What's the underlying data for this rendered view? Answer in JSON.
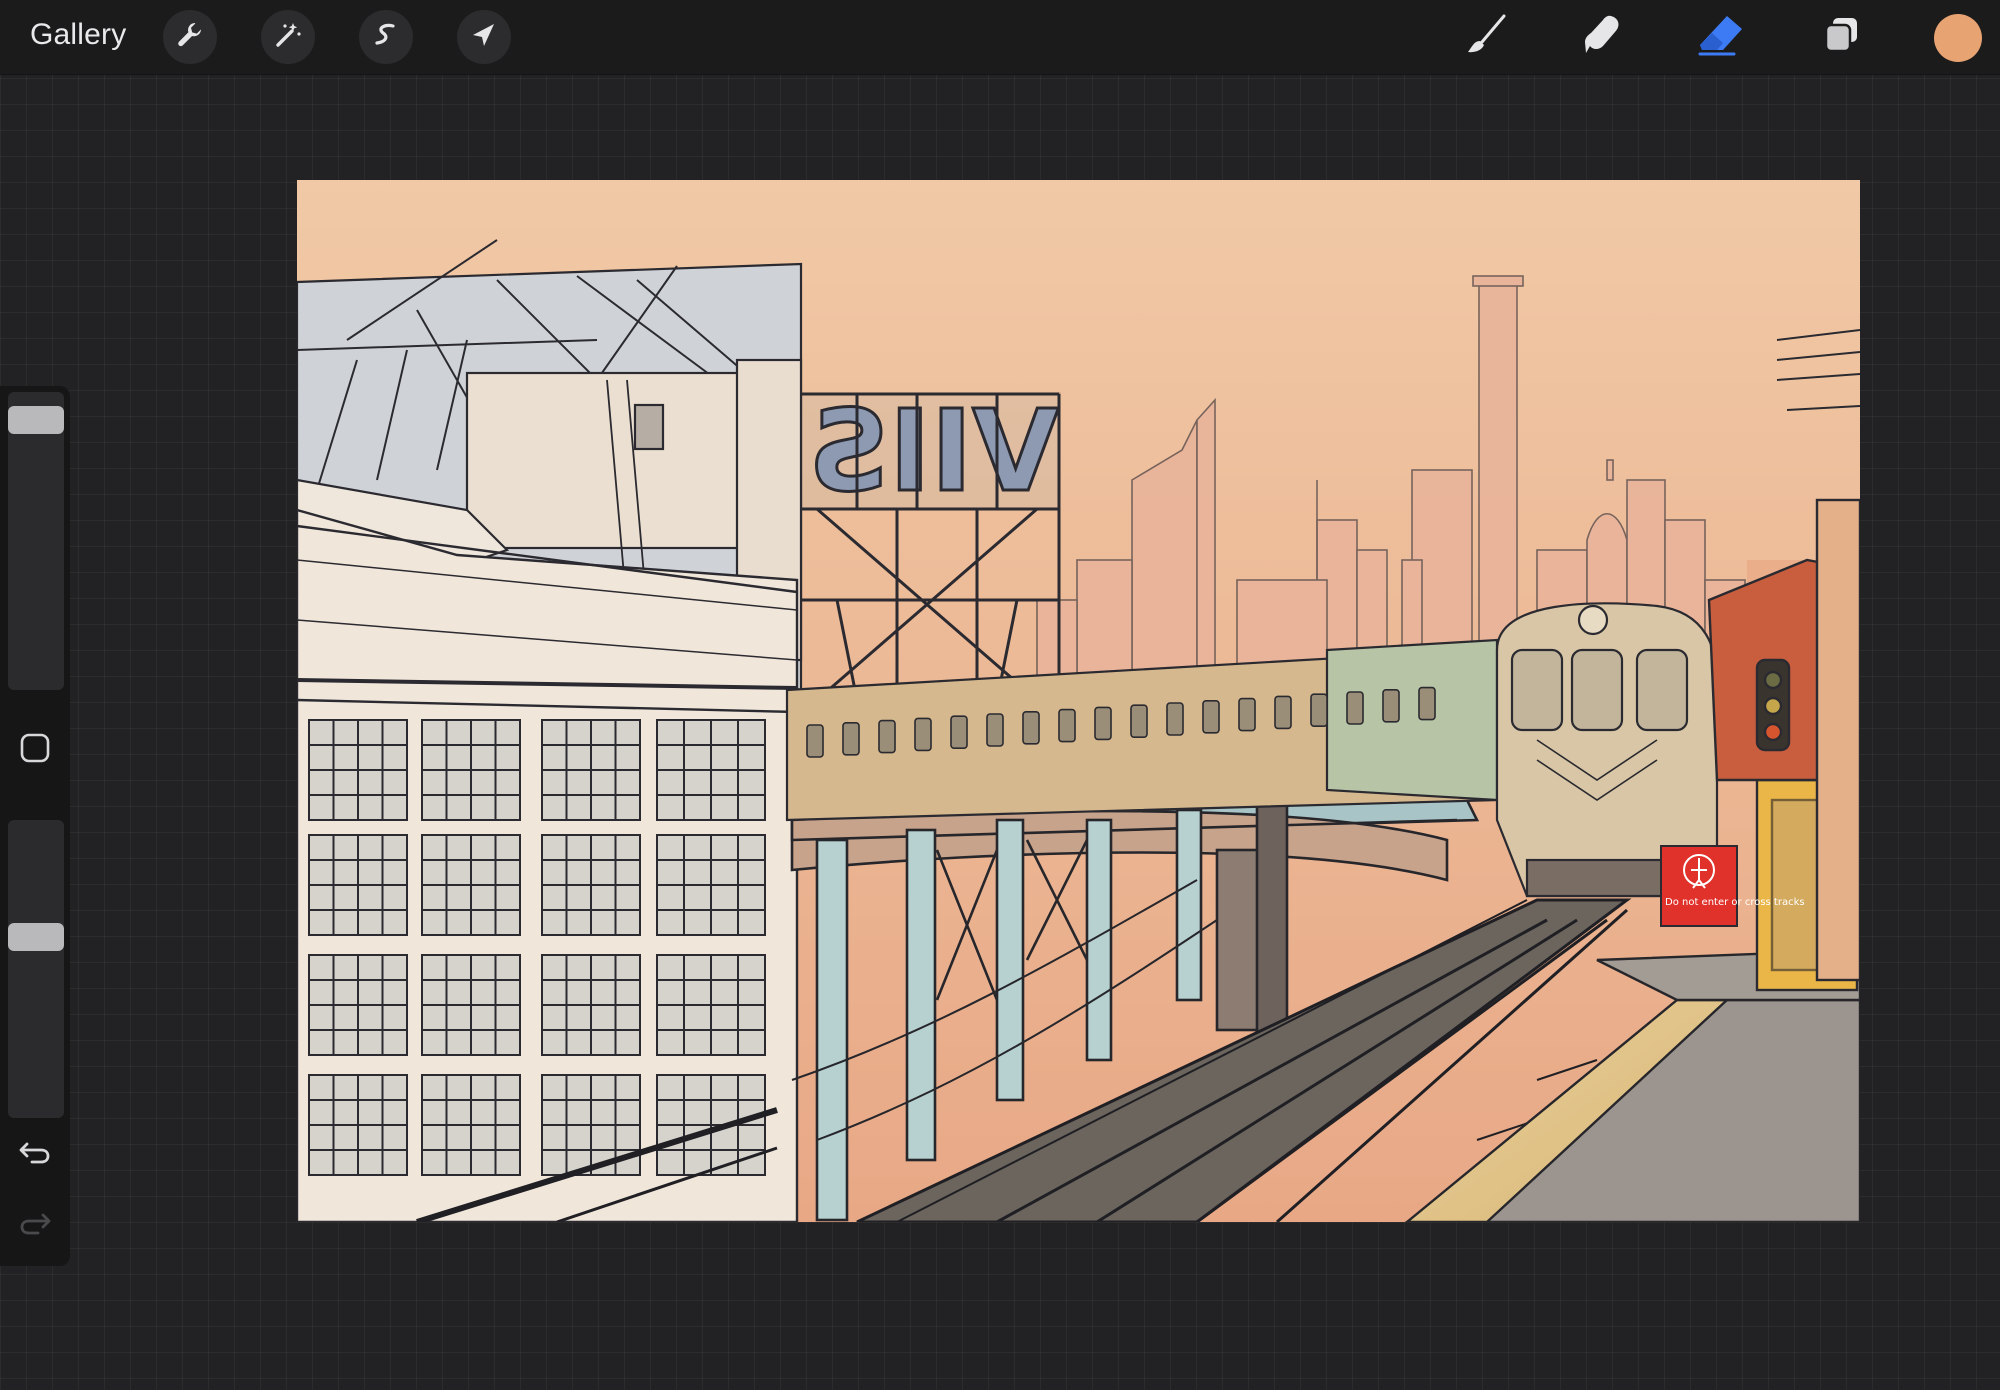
{
  "toolbar": {
    "gallery_label": "Gallery",
    "left_tools": [
      {
        "name": "actions",
        "icon": "wrench-icon"
      },
      {
        "name": "adjustments",
        "icon": "magic-wand-icon"
      },
      {
        "name": "selection",
        "icon": "selection-s-icon"
      },
      {
        "name": "transform",
        "icon": "arrow-cursor-icon"
      }
    ],
    "right_tools": [
      {
        "name": "brush",
        "icon": "brush-icon",
        "active": false
      },
      {
        "name": "smudge",
        "icon": "smudge-finger-icon",
        "active": false
      },
      {
        "name": "eraser",
        "icon": "eraser-icon",
        "active": true
      },
      {
        "name": "layers",
        "icon": "layers-icon",
        "active": false
      }
    ],
    "current_color": "#E8A372",
    "active_tool_color": "#3D7BF5"
  },
  "sidebar": {
    "brush_size_level": 0.95,
    "opacity_level": 0.62,
    "buttons": [
      {
        "name": "modify",
        "icon": "square-outline-icon"
      },
      {
        "name": "undo",
        "icon": "undo-arrow-icon"
      },
      {
        "name": "redo",
        "icon": "redo-arrow-icon",
        "enabled": false
      }
    ]
  },
  "artwork": {
    "sky_colors": [
      "#F1C9A6",
      "#ECB895",
      "#E8A886"
    ],
    "sign_text": "Do not enter or cross tracks",
    "sign_color": "#E0322A",
    "billboard_text": "VIIS"
  }
}
